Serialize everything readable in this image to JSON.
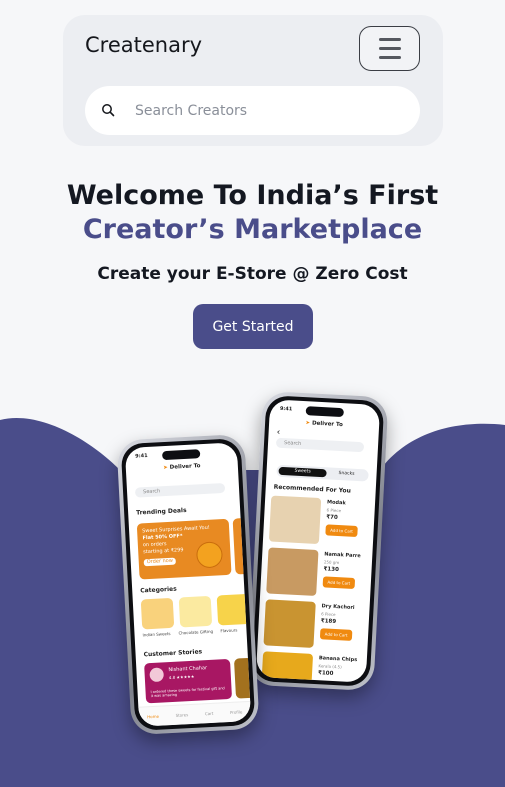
{
  "header": {
    "brand": "Createnary",
    "menu_icon": "hamburger-menu-icon",
    "search_placeholder": "Search Creators",
    "search_icon": "search-icon"
  },
  "hero": {
    "line1": "Welcome To India’s First",
    "line2": "Creator’s Marketplace",
    "subtitle": "Create your E-Store @ Zero Cost",
    "cta_label": "Get Started"
  },
  "colors": {
    "accent": "#4a4d8a",
    "background": "#f6f7f9",
    "orange": "#f08a10"
  },
  "front_phone": {
    "time": "9:41",
    "deliver_to": "Deliver To",
    "search_placeholder": "Search",
    "trending_title": "Trending Deals",
    "promo_line1": "Sweet Surprises Await You!",
    "promo_line2": "Flat 50% OFF*",
    "promo_line3": "on orders",
    "promo_line4": "starting at ₹299",
    "promo_cta": "Order now",
    "categories_title": "Categories",
    "categories": [
      "Indian Sweets",
      "Chocolate Gifting",
      "Flavours"
    ],
    "stories_title": "Customer Stories",
    "story_name": "Nishant Chahar",
    "story_rating": "4.8 ★★★★★",
    "story_text": "I ordered these sweets for festival gift and it was amazing",
    "tabs": [
      "Home",
      "Stores",
      "Cart",
      "Profile"
    ]
  },
  "back_phone": {
    "time": "9:41",
    "deliver_to": "Deliver To",
    "search_placeholder": "Search",
    "segment_active": "Sweets",
    "segment_inactive": "Snacks",
    "recommended_title": "Recommended For You",
    "products": [
      {
        "name": "Modak",
        "sub": "6 Piece",
        "price": "₹70",
        "cta": "Add to Cart"
      },
      {
        "name": "Namak Parre",
        "sub": "250 gm",
        "price": "₹130",
        "cta": "Add to Cart"
      },
      {
        "name": "Dry Kachori",
        "sub": "6 Piece",
        "price": "₹189",
        "cta": "Add to Cart"
      },
      {
        "name": "Banana Chips",
        "sub": "Kerala (4.5)",
        "price": "₹100",
        "cta": "Add to Cart"
      }
    ]
  }
}
